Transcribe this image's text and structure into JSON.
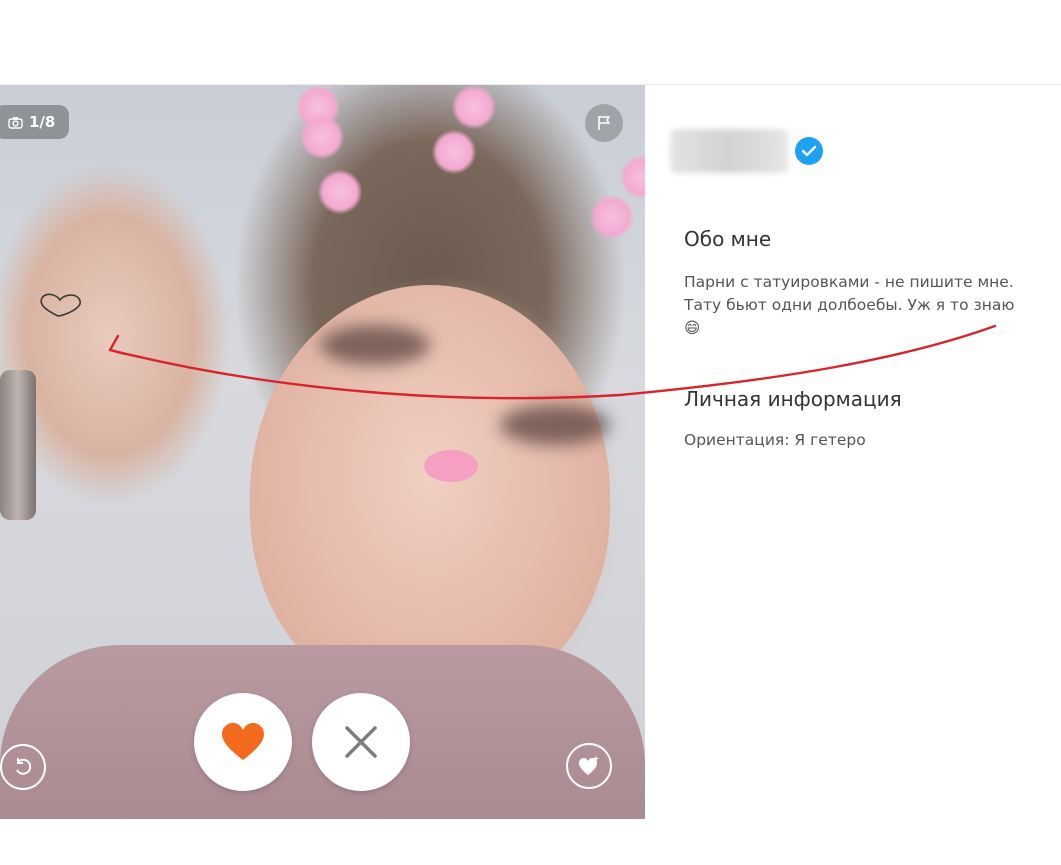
{
  "photo": {
    "counter": "1/8"
  },
  "profile": {
    "about_title": "Обо мне",
    "about_text": "Парни с татуировками - не пишите мне. Тату бьют одни долбоебы. Уж я то знаю😄",
    "personal_title": "Личная информация",
    "orientation_text": "Ориентация: Я гетеро"
  },
  "icons": {
    "camera": "camera-icon",
    "flag": "flag-icon",
    "undo": "undo-icon",
    "like": "heart-icon",
    "pass": "close-icon",
    "super_like": "super-like-icon",
    "verified": "verified-check-icon"
  },
  "colors": {
    "like_heart": "#f26b1d",
    "pass_x": "#7d7d7d",
    "verified": "#1da1f2",
    "annotation": "#d7262b"
  }
}
